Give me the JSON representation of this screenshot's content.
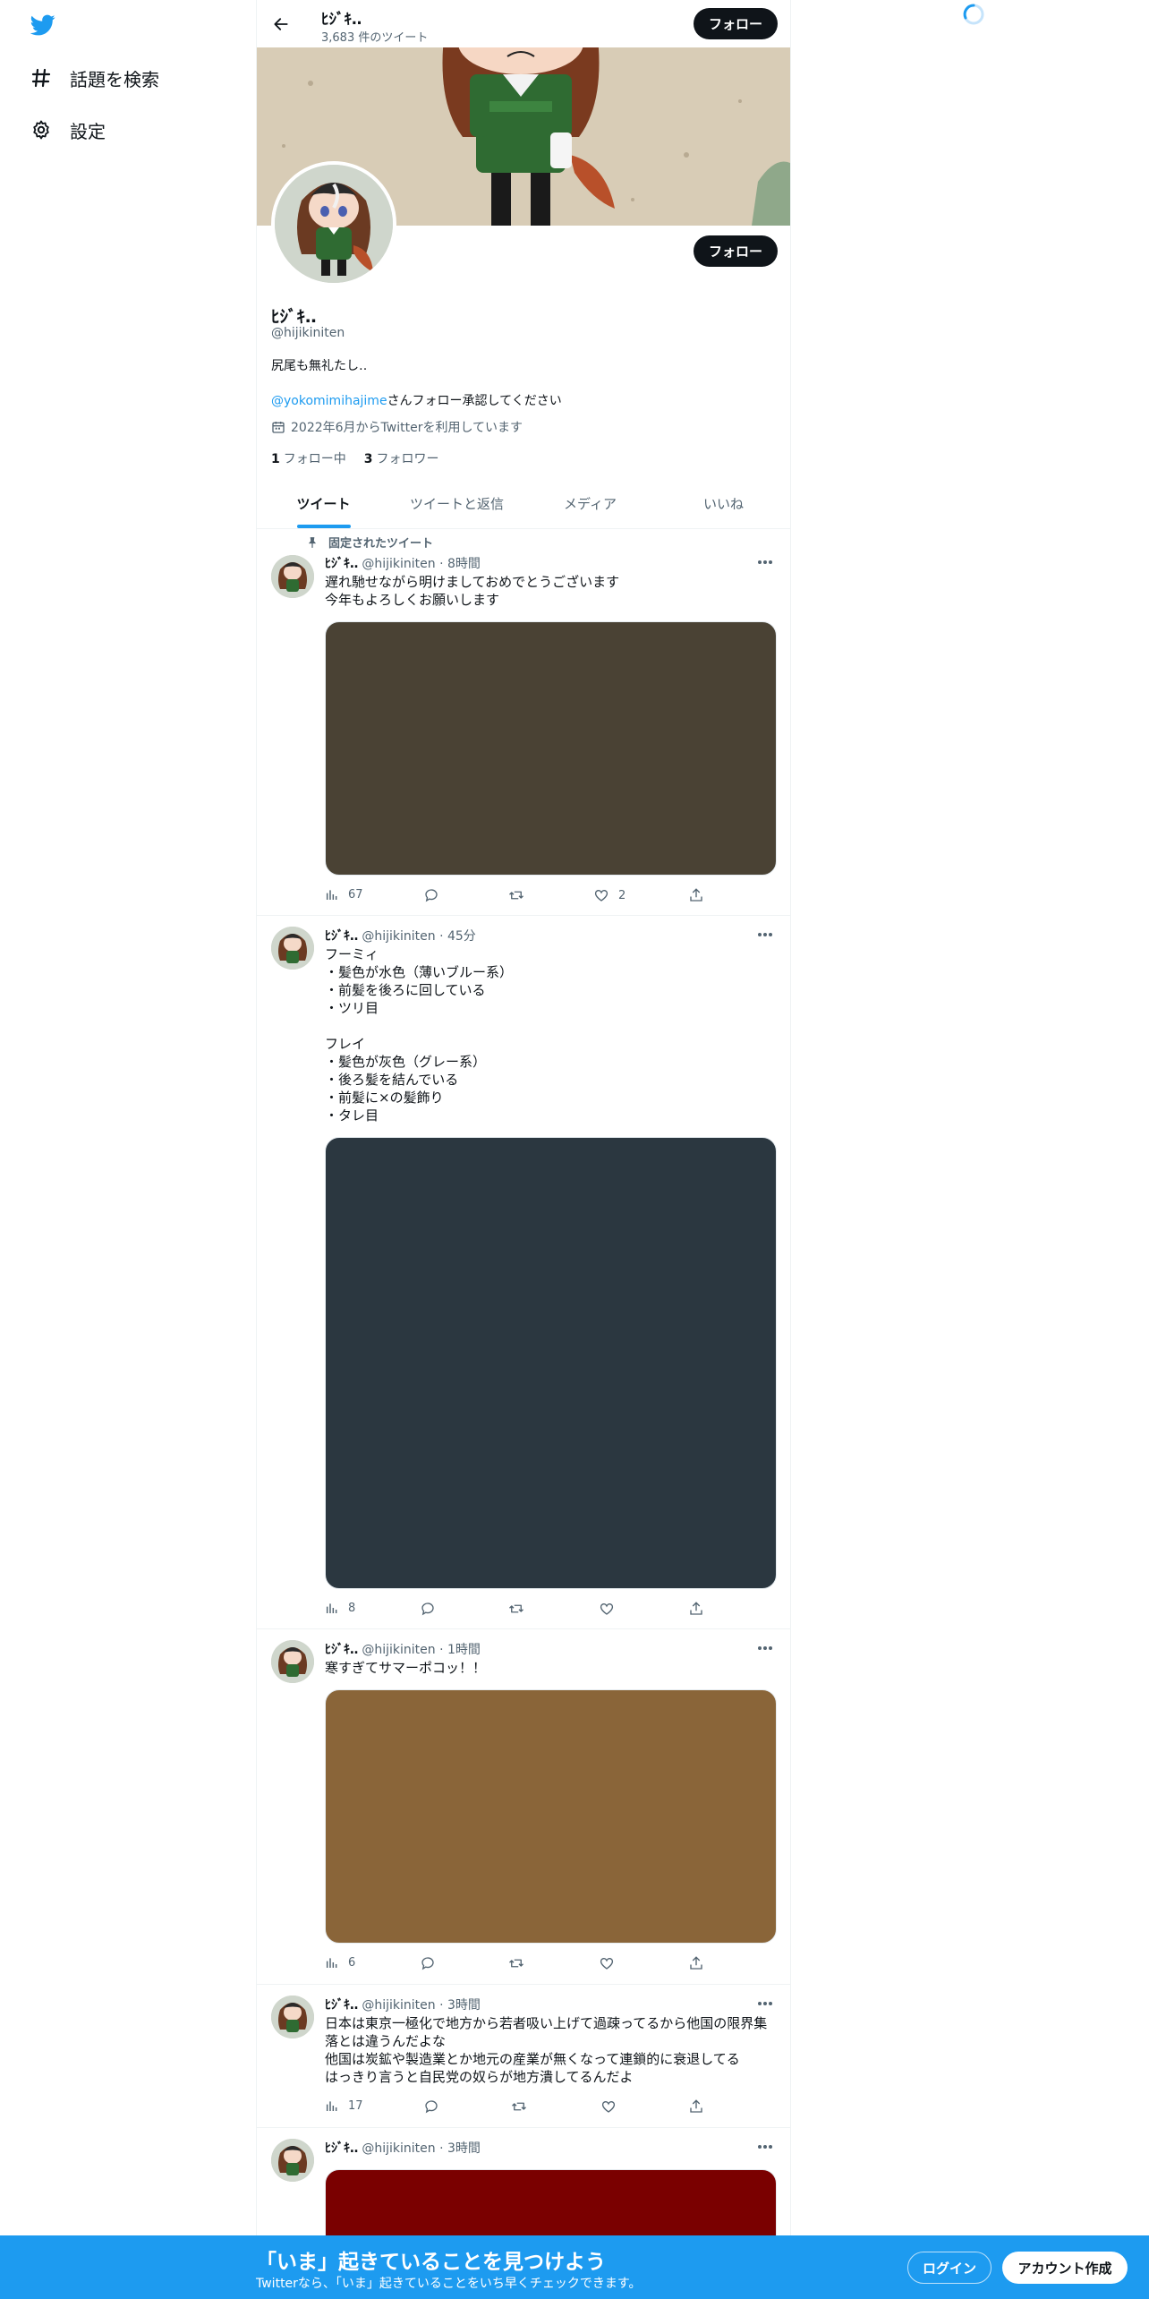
{
  "nav": {
    "logo": "twitter-bird-icon",
    "items": [
      {
        "label": "話題を検索",
        "icon": "hashtag-icon"
      },
      {
        "label": "設定",
        "icon": "gear-icon"
      }
    ]
  },
  "header": {
    "name": "ﾋｼﾞｷ‥",
    "tweet_count": "3,683 件のツイート",
    "follow_label": "フォロー"
  },
  "profile": {
    "name": "ﾋｼﾞｷ‥",
    "handle": "@hijikiniten",
    "follow_label": "フォロー",
    "bio": "尻尾も無礼たし‥",
    "bio_mention": "@yokomimihajime",
    "bio_rest": "さんフォロー承認してください",
    "joined": "2022年6月からTwitterを利用しています",
    "following_count": "1",
    "following_label": "フォロー中",
    "followers_count": "3",
    "followers_label": "フォロワー"
  },
  "tabs": [
    {
      "label": "ツイート",
      "active": true
    },
    {
      "label": "ツイートと返信",
      "active": false
    },
    {
      "label": "メディア",
      "active": false
    },
    {
      "label": "いいね",
      "active": false
    }
  ],
  "pinned_label": "固定されたツイート",
  "tweets": [
    {
      "name": "ﾋｼﾞｷ‥",
      "handle": "@hijikiniten",
      "time": "· 8時間",
      "text": "遅れ馳せながら明けましておめでとうございます\n今年もよろしくお願いします",
      "media_color": "#4a4234",
      "views": "67",
      "replies": "",
      "retweets": "",
      "likes": "2"
    },
    {
      "name": "ﾋｼﾞｷ‥",
      "handle": "@hijikiniten",
      "time": "· 45分",
      "text": "フーミィ\n・髪色が水色（薄いブルー系）\n・前髪を後ろに回している\n・ツリ目\n\nフレイ\n・髪色が灰色（グレー系）\n・後ろ髪を結んでいる\n・前髪に×の髪飾り\n・タレ目",
      "media_color": "#2b3740",
      "views": "8",
      "replies": "",
      "retweets": "",
      "likes": ""
    },
    {
      "name": "ﾋｼﾞｷ‥",
      "handle": "@hijikiniten",
      "time": "· 1時間",
      "text": "寒すぎてサマーポコッ！！",
      "media_color": "#8a6539",
      "views": "6",
      "replies": "",
      "retweets": "",
      "likes": ""
    },
    {
      "name": "ﾋｼﾞｷ‥",
      "handle": "@hijikiniten",
      "time": "· 3時間",
      "text": "日本は東京一極化で地方から若者吸い上げて過疎ってるから他国の限界集落とは違うんだよな\n他国は炭鉱や製造業とか地元の産業が無くなって連鎖的に衰退してる\nはっきり言うと自民党の奴らが地方潰してるんだよ",
      "views": "17",
      "replies": "",
      "retweets": "",
      "likes": ""
    },
    {
      "name": "ﾋｼﾞｷ‥",
      "handle": "@hijikiniten",
      "time": "· 3時間",
      "media_color": "#7a0000"
    }
  ],
  "bottom": {
    "title": "「いま」起きていることを見つけよう",
    "subtitle": "Twitterなら、「いま」起きていることをいち早くチェックできます。",
    "login": "ログイン",
    "signup": "アカウント作成",
    "color": "#1d9bf0"
  }
}
